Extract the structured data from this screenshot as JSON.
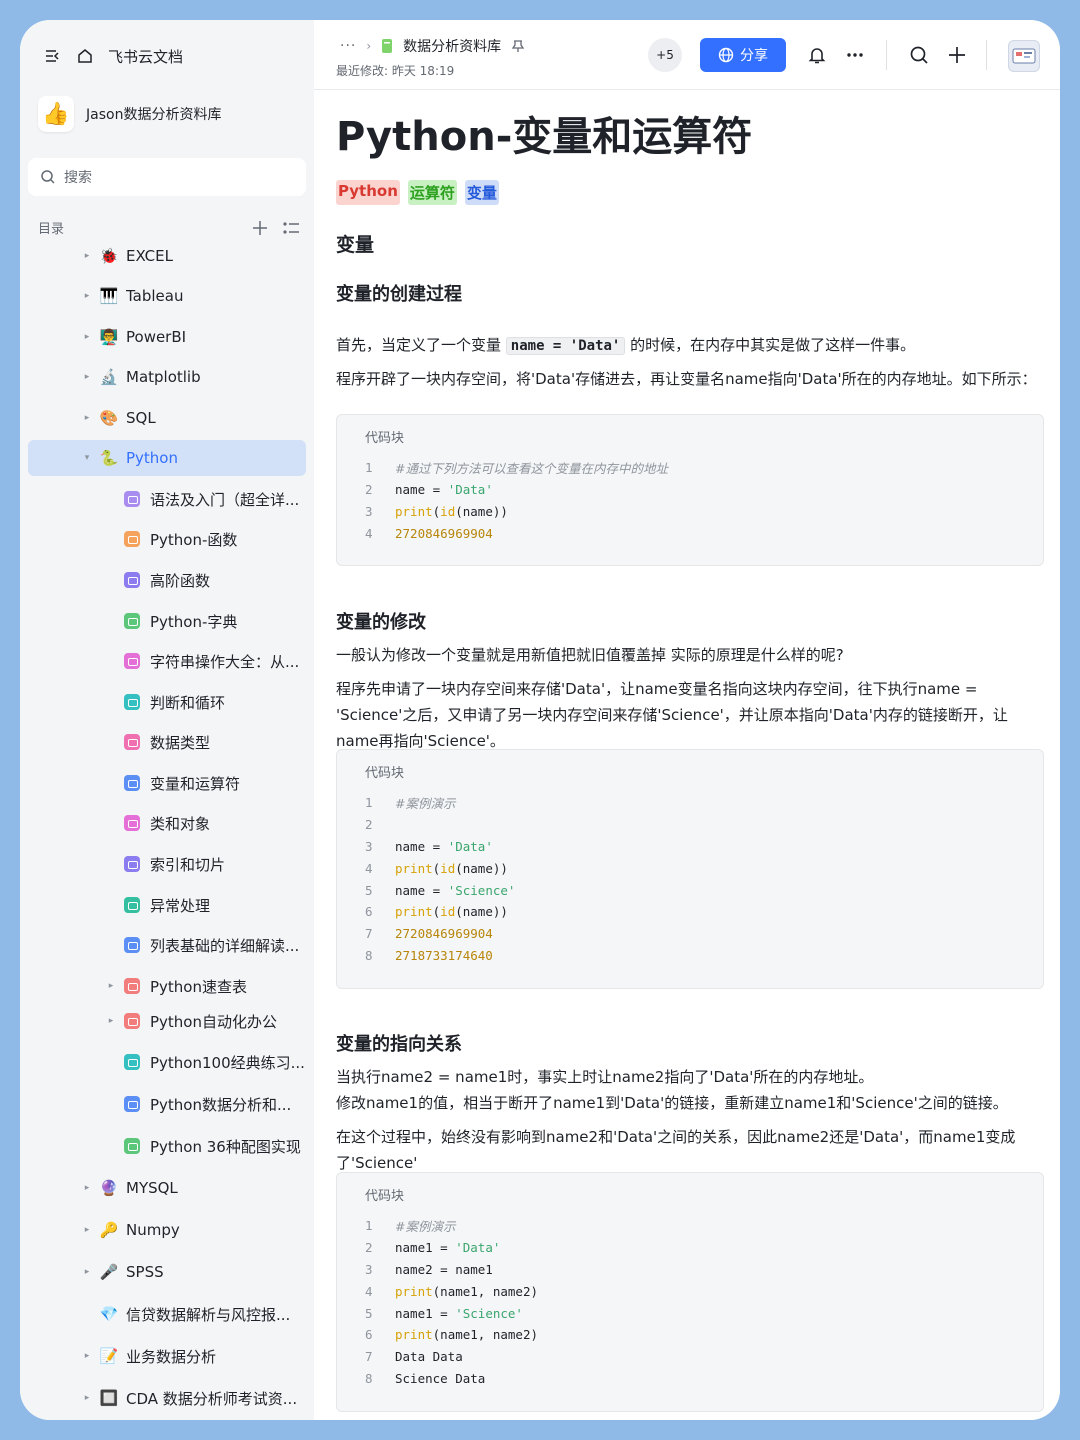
{
  "sidebar": {
    "app_name": "飞书云文档",
    "library_name": "Jason数据分析资料库",
    "library_emoji": "👍",
    "search_placeholder": "搜索",
    "toc_label": "目录",
    "items": [
      {
        "label": "EXCEL",
        "emoji": "🐞",
        "type": "folder"
      },
      {
        "label": "Tableau",
        "emoji": "🎹",
        "type": "folder"
      },
      {
        "label": "PowerBI",
        "emoji": "👨‍🏫",
        "type": "folder"
      },
      {
        "label": "Matplotlib",
        "emoji": "🔬",
        "type": "folder"
      },
      {
        "label": "SQL",
        "emoji": "🎨",
        "type": "folder"
      },
      {
        "label": "Python",
        "emoji": "🐍",
        "type": "folder-open"
      },
      {
        "label": "语法及入门（超全详...",
        "color": "#a98cf0",
        "type": "doc"
      },
      {
        "label": "Python-函数",
        "color": "#f5a35c",
        "type": "doc"
      },
      {
        "label": "高阶函数",
        "color": "#8b7cf0",
        "type": "doc"
      },
      {
        "label": "Python-字典",
        "color": "#5cc77a",
        "type": "doc"
      },
      {
        "label": "字符串操作大全：从...",
        "color": "#e46fd6",
        "type": "doc"
      },
      {
        "label": "判断和循环",
        "color": "#34c0c0",
        "type": "doc"
      },
      {
        "label": "数据类型",
        "color": "#ef6fb0",
        "type": "doc"
      },
      {
        "label": "变量和运算符",
        "color": "#5b8ff5",
        "type": "doc"
      },
      {
        "label": "类和对象",
        "color": "#e46fd6",
        "type": "doc"
      },
      {
        "label": "索引和切片",
        "color": "#8b7cf0",
        "type": "doc"
      },
      {
        "label": "异常处理",
        "color": "#34c0a0",
        "type": "doc"
      },
      {
        "label": "列表基础的详细解读...",
        "color": "#5b8ff5",
        "type": "doc"
      },
      {
        "label": "Python速查表",
        "color": "#f27d7d",
        "type": "doc-folder"
      },
      {
        "label": "Python自动化办公",
        "color": "#f27d7d",
        "type": "doc-folder"
      },
      {
        "label": "Python100经典练习...",
        "color": "#34c0c0",
        "type": "doc"
      },
      {
        "label": "Python数据分析和...",
        "color": "#5b8ff5",
        "type": "doc"
      },
      {
        "label": "Python 36种配图实现",
        "color": "#5cc77a",
        "type": "doc"
      },
      {
        "label": "MYSQL",
        "emoji": "🔮",
        "type": "folder"
      },
      {
        "label": "Numpy",
        "emoji": "🔑",
        "type": "folder"
      },
      {
        "label": "SPSS",
        "emoji": "🎤",
        "type": "folder"
      },
      {
        "label": "信贷数据解析与风控报...",
        "emoji": "💎",
        "type": "leaf"
      },
      {
        "label": "业务数据分析",
        "emoji": "📝",
        "type": "folder"
      },
      {
        "label": "CDA 数据分析师考试资...",
        "emoji": "🔲",
        "type": "folder"
      }
    ]
  },
  "header": {
    "breadcrumb_more": "···",
    "doc_name": "数据分析资料库",
    "last_modified": "最近修改: 昨天 18:19",
    "collaborators": "+5",
    "share_label": "分享"
  },
  "doc": {
    "title": "Python-变量和运算符",
    "tags": [
      {
        "label": "Python",
        "bg": "#fbd4d0",
        "fg": "#d83931"
      },
      {
        "label": "运算符",
        "bg": "#c8f0c2",
        "fg": "#2ea121"
      },
      {
        "label": "变量",
        "bg": "#cfdcf8",
        "fg": "#245bdb"
      }
    ],
    "h_var": "变量",
    "h_create": "变量的创建过程",
    "p1_before": "首先，当定义了一个变量 ",
    "p1_code": "name = 'Data'",
    "p1_after": " 的时候，在内存中其实是做了这样一件事。",
    "p2": "程序开辟了一块内存空间，将'Data'存储进去，再让变量名name指向'Data'所在的内存地址。如下所示：",
    "code_label": "代码块",
    "code1": [
      {
        "n": "1",
        "parts": [
          {
            "t": "#通过下列方法可以查看这个变量在内存中的地址",
            "c": "cm"
          }
        ]
      },
      {
        "n": "2",
        "parts": [
          {
            "t": "name = ",
            "c": "txt"
          },
          {
            "t": "'Data'",
            "c": "str"
          }
        ]
      },
      {
        "n": "3",
        "parts": [
          {
            "t": "print",
            "c": "fn"
          },
          {
            "t": "(",
            "c": "txt"
          },
          {
            "t": "id",
            "c": "fn"
          },
          {
            "t": "(name))",
            "c": "txt"
          }
        ]
      },
      {
        "n": "4",
        "parts": [
          {
            "t": "2720846969904",
            "c": "num"
          }
        ]
      }
    ],
    "h_modify": "变量的修改",
    "p3": "一般认为修改一个变量就是用新值把就旧值覆盖掉 实际的原理是什么样的呢?",
    "p4": "程序先申请了一块内存空间来存储'Data'，让name变量名指向这块内存空间，往下执行name = 'Science'之后，又申请了另一块内存空间来存储'Science'，并让原本指向'Data'内存的链接断开，让name再指向'Science'。",
    "code2": [
      {
        "n": "1",
        "parts": [
          {
            "t": "#案例演示",
            "c": "cm"
          }
        ]
      },
      {
        "n": "2",
        "parts": []
      },
      {
        "n": "3",
        "parts": [
          {
            "t": "name = ",
            "c": "txt"
          },
          {
            "t": "'Data'",
            "c": "str"
          }
        ]
      },
      {
        "n": "4",
        "parts": [
          {
            "t": "print",
            "c": "fn"
          },
          {
            "t": "(",
            "c": "txt"
          },
          {
            "t": "id",
            "c": "fn"
          },
          {
            "t": "(name))",
            "c": "txt"
          }
        ]
      },
      {
        "n": "5",
        "parts": [
          {
            "t": "name = ",
            "c": "txt"
          },
          {
            "t": "'Science'",
            "c": "str"
          }
        ]
      },
      {
        "n": "6",
        "parts": [
          {
            "t": "print",
            "c": "fn"
          },
          {
            "t": "(",
            "c": "txt"
          },
          {
            "t": "id",
            "c": "fn"
          },
          {
            "t": "(name))",
            "c": "txt"
          }
        ]
      },
      {
        "n": "7",
        "parts": [
          {
            "t": "2720846969904",
            "c": "num"
          }
        ]
      },
      {
        "n": "8",
        "parts": [
          {
            "t": "2718733174640",
            "c": "num"
          }
        ]
      }
    ],
    "h_point": "变量的指向关系",
    "p5": "当执行name2 = name1时，事实上时让name2指向了'Data'所在的内存地址。",
    "p6": "修改name1的值，相当于断开了name1到'Data'的链接，重新建立name1和'Science'之间的链接。",
    "p7": "在这个过程中，始终没有影响到name2和'Data'之间的关系，因此name2还是'Data'，而name1变成了'Science'",
    "code3": [
      {
        "n": "1",
        "parts": [
          {
            "t": "#案例演示",
            "c": "cm"
          }
        ]
      },
      {
        "n": "2",
        "parts": [
          {
            "t": "name1 = ",
            "c": "txt"
          },
          {
            "t": "'Data'",
            "c": "str"
          }
        ]
      },
      {
        "n": "3",
        "parts": [
          {
            "t": "name2 = name1",
            "c": "txt"
          }
        ]
      },
      {
        "n": "4",
        "parts": [
          {
            "t": "print",
            "c": "fn"
          },
          {
            "t": "(name1, name2)",
            "c": "txt"
          }
        ]
      },
      {
        "n": "5",
        "parts": [
          {
            "t": "name1 = ",
            "c": "txt"
          },
          {
            "t": "'Science'",
            "c": "str"
          }
        ]
      },
      {
        "n": "6",
        "parts": [
          {
            "t": "print",
            "c": "fn"
          },
          {
            "t": "(name1, name2)",
            "c": "txt"
          }
        ]
      },
      {
        "n": "7",
        "parts": [
          {
            "t": "Data Data",
            "c": "txt"
          }
        ]
      },
      {
        "n": "8",
        "parts": [
          {
            "t": "Science Data",
            "c": "txt"
          }
        ]
      }
    ]
  }
}
